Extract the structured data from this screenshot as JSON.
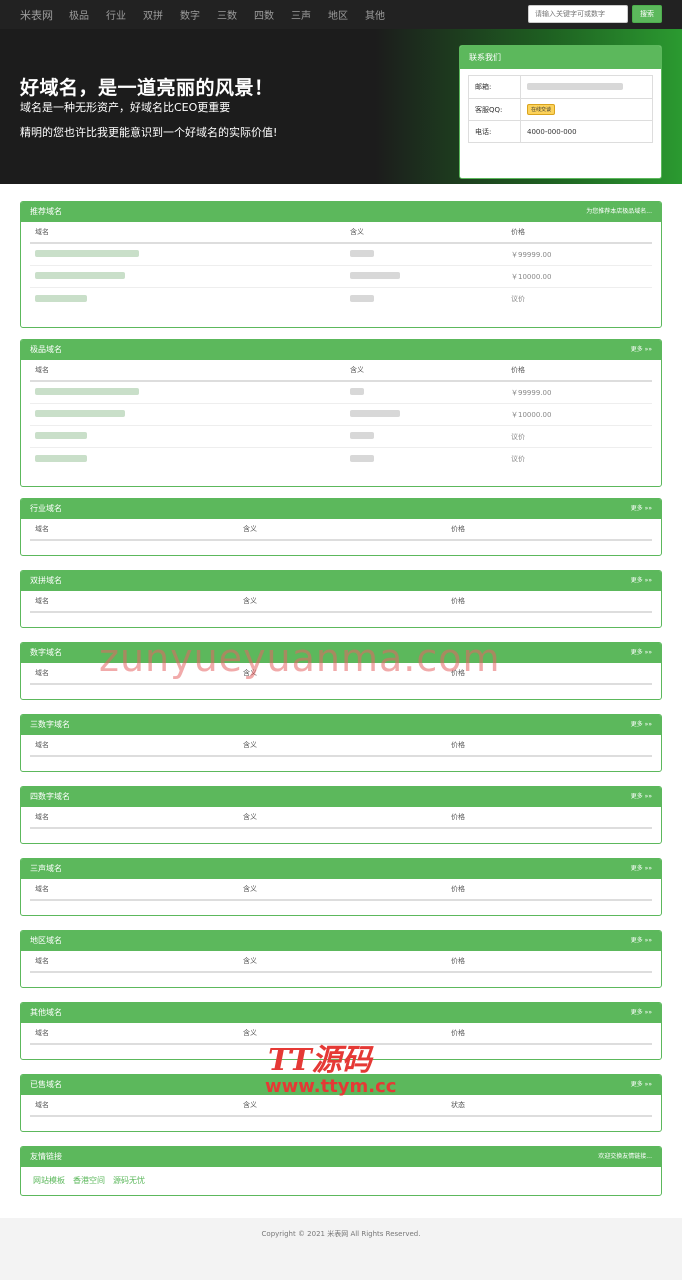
{
  "nav": {
    "brand": "米表网",
    "items": [
      "极品",
      "行业",
      "双拼",
      "数字",
      "三数",
      "四数",
      "三声",
      "地区",
      "其他"
    ],
    "search_placeholder": "请输入关键字可或数字",
    "search_button": "搜索"
  },
  "hero": {
    "title": "好域名，是一道亮丽的风景！",
    "sub1": "域名是一种无形资产，好域名比CEO更重要",
    "sub2": "精明的您也许比我更能意识到一个好域名的实际价值!"
  },
  "contact": {
    "title": "联系我们",
    "email_label": "邮箱:",
    "qq_label": "客服QQ:",
    "qq_button": "在线交谈",
    "phone_label": "电话:",
    "phone_value": "4000-000-000"
  },
  "recommended": {
    "title": "推荐域名",
    "more": "为您推荐本店极品域名...",
    "headers": [
      "域名",
      "含义",
      "价格"
    ],
    "prices": [
      "￥99999.00",
      "￥10000.00",
      "议价"
    ]
  },
  "premium": {
    "title": "极品域名",
    "more": "更多 »»",
    "headers": [
      "域名",
      "含义",
      "价格"
    ],
    "prices": [
      "￥99999.00",
      "￥10000.00",
      "议价",
      "议价"
    ]
  },
  "sections": [
    {
      "title": "行业域名",
      "more": "更多 »»",
      "headers": [
        "域名",
        "含义",
        "价格"
      ]
    },
    {
      "title": "双拼域名",
      "more": "更多 »»",
      "headers": [
        "域名",
        "含义",
        "价格"
      ]
    },
    {
      "title": "数字域名",
      "more": "更多 »»",
      "headers": [
        "域名",
        "含义",
        "价格"
      ]
    },
    {
      "title": "三数字域名",
      "more": "更多 »»",
      "headers": [
        "域名",
        "含义",
        "价格"
      ]
    },
    {
      "title": "四数字域名",
      "more": "更多 »»",
      "headers": [
        "域名",
        "含义",
        "价格"
      ]
    },
    {
      "title": "三声域名",
      "more": "更多 »»",
      "headers": [
        "域名",
        "含义",
        "价格"
      ]
    },
    {
      "title": "地区域名",
      "more": "更多 »»",
      "headers": [
        "域名",
        "含义",
        "价格"
      ]
    },
    {
      "title": "其他域名",
      "more": "更多 »»",
      "headers": [
        "域名",
        "含义",
        "价格"
      ]
    },
    {
      "title": "已售域名",
      "more": "更多 »»",
      "headers": [
        "域名",
        "含义",
        "状态"
      ]
    }
  ],
  "friends": {
    "title": "友情链接",
    "more": "欢迎交换友情链接...",
    "links": [
      "网站模板",
      "香港空间",
      "源码无忧"
    ]
  },
  "footer": {
    "copyright": "Copyright © 2021 米表网 All Rights Reserved."
  },
  "watermarks": {
    "main": "zunyueyuanma.com",
    "ttym_cn": "TT源码",
    "ttym_url": "www.ttym.cc"
  }
}
